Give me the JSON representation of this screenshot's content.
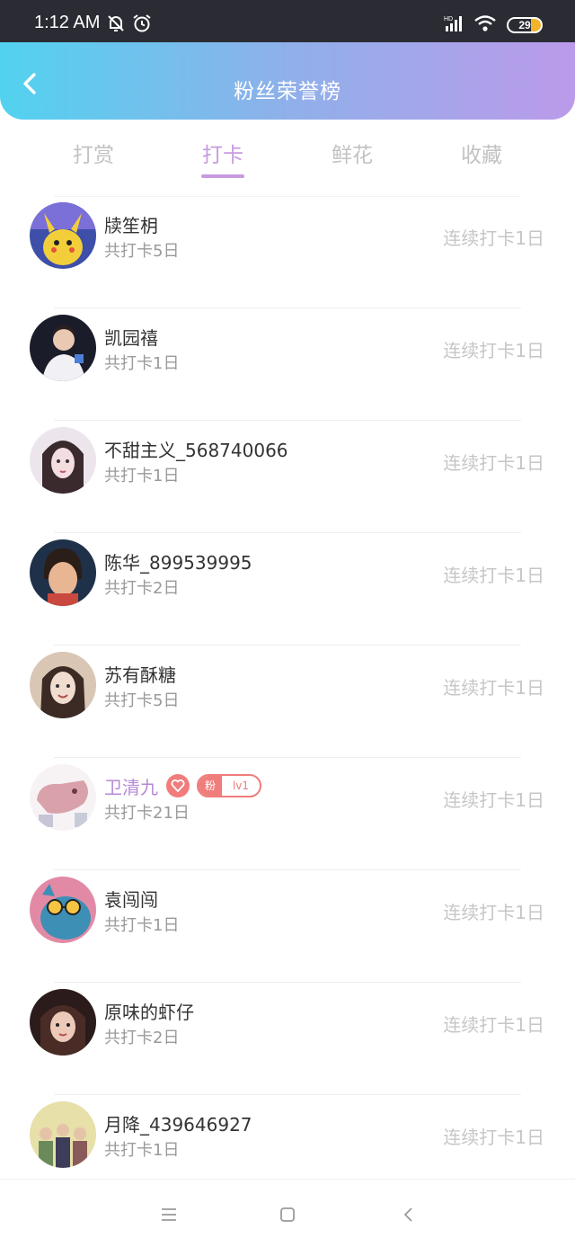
{
  "status_bar": {
    "time": "1:12 AM",
    "battery": "29"
  },
  "header": {
    "title": "粉丝荣誉榜"
  },
  "tabs": [
    {
      "label": "打赏"
    },
    {
      "label": "打卡"
    },
    {
      "label": "鲜花"
    },
    {
      "label": "收藏"
    }
  ],
  "active_tab": "打卡",
  "fan_badge": {
    "label": "粉",
    "level": "lv1"
  },
  "fans": [
    {
      "name": "牍笙枂",
      "total": "共打卡5日",
      "streak": "连续打卡1日"
    },
    {
      "name": "凯园禧",
      "total": "共打卡1日",
      "streak": "连续打卡1日"
    },
    {
      "name": "不甜主义_568740066",
      "total": "共打卡1日",
      "streak": "连续打卡1日"
    },
    {
      "name": "陈华_899539995",
      "total": "共打卡2日",
      "streak": "连续打卡1日"
    },
    {
      "name": "苏有酥糖",
      "total": "共打卡5日",
      "streak": "连续打卡1日"
    },
    {
      "name": "卫清九",
      "total": "共打卡21日",
      "streak": "连续打卡1日"
    },
    {
      "name": "袁闯闯",
      "total": "共打卡1日",
      "streak": "连续打卡1日"
    },
    {
      "name": "原味的虾仔",
      "total": "共打卡2日",
      "streak": "连续打卡1日"
    },
    {
      "name": "月降_439646927",
      "total": "共打卡1日",
      "streak": "连续打卡1日"
    }
  ],
  "colors": {
    "header_gradient_start": "#52d2ef",
    "header_gradient_end": "#bb9aea",
    "active_tab": "#c79ae0",
    "vip_name": "#b58ad6",
    "badge": "#f07c7c"
  }
}
